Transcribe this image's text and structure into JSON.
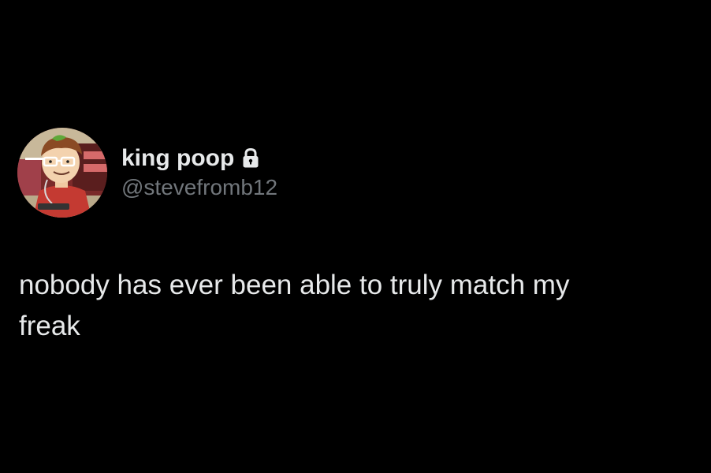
{
  "tweet": {
    "display_name": "king poop",
    "handle": "@stevefromb12",
    "protected_icon": "lock-icon",
    "avatar_icon": "cartoon-avatar",
    "text": "nobody has ever been able to truly match my\nfreak"
  },
  "colors": {
    "background": "#000000",
    "primary_text": "#e7e9ea",
    "secondary_text": "#71767b"
  }
}
